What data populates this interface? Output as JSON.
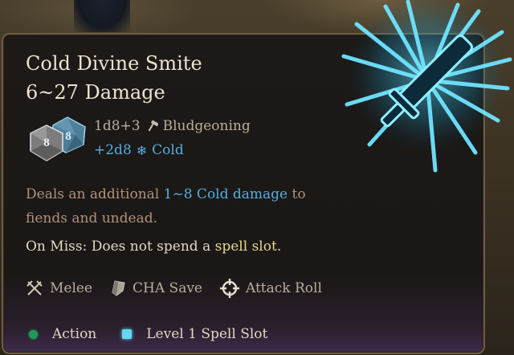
{
  "tooltip": {
    "title": "Cold Divine Smite",
    "subtitle": "6~27 Damage",
    "dice": {
      "front_face": "8",
      "back_face": "8"
    },
    "damage": {
      "base_roll": "1d8+3",
      "base_type": "Bludgeoning",
      "bonus_roll": "+2d8",
      "bonus_type": "Cold"
    },
    "description": {
      "prefix": "Deals an additional ",
      "highlight": "1~8 Cold damage",
      "suffix": " to fiends and undead."
    },
    "on_miss": {
      "prefix": "On Miss: Does not spend a ",
      "highlight": "spell slot",
      "suffix": "."
    },
    "properties": [
      "Melee",
      "CHA Save",
      "Attack Roll"
    ],
    "costs": {
      "action": "Action",
      "spell_slot": "Level 1 Spell Slot"
    }
  },
  "colors": {
    "cold": "#55aee0",
    "spell_slot_highlight": "#e8d890",
    "action_dot": "#1f9a56",
    "spell_slot_square": "#62d8f2"
  },
  "icons": {
    "bludgeoning": "hammer-icon",
    "cold": "snowflake-icon",
    "melee": "crossed-swords-icon",
    "cha_save": "shield-icon",
    "attack_roll": "crosshair-icon",
    "spell": "cold-smite-spell-icon"
  }
}
